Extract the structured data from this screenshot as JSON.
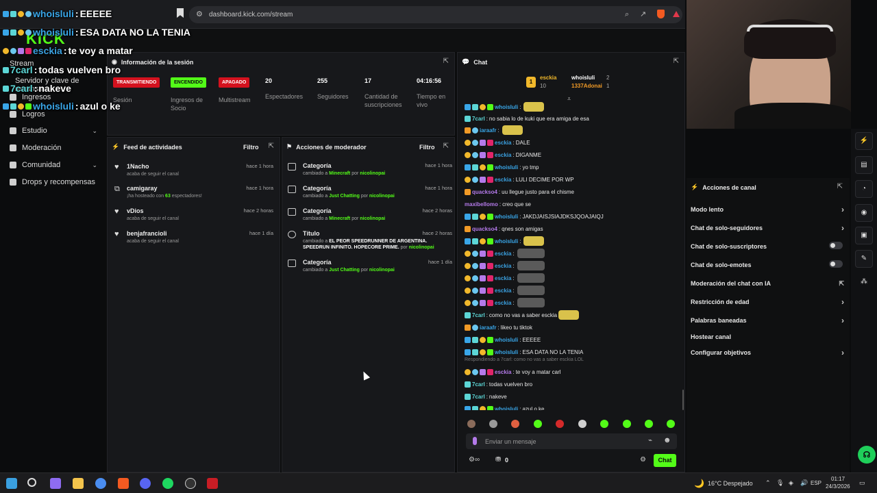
{
  "browser": {
    "url": "dashboard.kick.com/stream"
  },
  "overlay_chat": [
    {
      "user": "whoisluli",
      "text": "EEEEE",
      "color": "#39a6e8"
    },
    {
      "user": "whoisluli",
      "text": "ESA DATA NO LA TENIA",
      "color": "#39a6e8"
    },
    {
      "user": "esckia",
      "text": "te voy a matar",
      "color": "#3aa0e0"
    },
    {
      "user": "7carl",
      "text": "todas vuelven bro",
      "color": "#5cd6d6"
    },
    {
      "user": "7carl",
      "text": "nakeve",
      "color": "#5cd6d6"
    },
    {
      "user": "whoisluli",
      "text": "azul o ke",
      "color": "#39a6e8"
    }
  ],
  "sidebar": {
    "items": [
      {
        "label": "Stream"
      },
      {
        "label": "Servidor y clave de retransm"
      },
      {
        "label": "Ingresos"
      },
      {
        "label": "Logros"
      },
      {
        "label": "Estudio"
      },
      {
        "label": "Moderación"
      },
      {
        "label": "Comunidad"
      },
      {
        "label": "Drops y recompensas"
      }
    ]
  },
  "session": {
    "title": "Información de la sesión",
    "stats": [
      {
        "value": "TRANSMITIENDO",
        "label": "Sesión"
      },
      {
        "value": "ENCENDIDO",
        "label": "Ingresos de Socio"
      },
      {
        "value": "APAGADO",
        "label": "Multistream"
      },
      {
        "value": "20",
        "label": "Espectadores"
      },
      {
        "value": "255",
        "label": "Seguidores"
      },
      {
        "value": "17",
        "label": "Cantidad de suscripciones"
      },
      {
        "value": "04:16:56",
        "label": "Tiempo en vivo"
      }
    ]
  },
  "feed": {
    "title": "Feed de actividades",
    "filter": "Filtro",
    "items": [
      {
        "name": "1Nacho",
        "sub": "acaba de seguir el canal",
        "time": "hace 1 hora"
      },
      {
        "name": "camigaray",
        "sub_pre": "¡ha hosteado con ",
        "sub_num": "63",
        "sub_post": " espectadores!",
        "time": "hace 1 hora"
      },
      {
        "name": "vDios",
        "sub": "acaba de seguir el canal",
        "time": "hace 2 horas"
      },
      {
        "name": "benjafrancioli",
        "sub": "acaba de seguir el canal",
        "time": "hace 1 día"
      }
    ]
  },
  "mod": {
    "title": "Acciones de moderador",
    "filter": "Filtro",
    "items": [
      {
        "name": "Categoría",
        "pre": "cambiado a ",
        "target": "Minecraft",
        "mid": " por ",
        "by": "nicolinopai",
        "time": "hace 1 hora"
      },
      {
        "name": "Categoría",
        "pre": "cambiado a ",
        "target": "Just Chatting",
        "mid": " por ",
        "by": "nicolinopai",
        "time": "hace 1 hora"
      },
      {
        "name": "Categoría",
        "pre": "cambiado a ",
        "target": "Minecraft",
        "mid": " por ",
        "by": "nicolinopai",
        "time": "hace 2 horas"
      },
      {
        "name": "Título",
        "pre": "cambiado a ",
        "target": "EL PEOR SPEEDRUNNER DE ARGENTINA. SPEEDRUN INFINITO. HOPECORE PRIME.",
        "mid": " por ",
        "by": "nicolinopai",
        "time": "hace 2 horas"
      },
      {
        "name": "Categoría",
        "pre": "cambiado a ",
        "target": "Just Chatting",
        "mid": " por ",
        "by": "nicolinopai",
        "time": "hace 1 día"
      }
    ]
  },
  "chat": {
    "title": "Chat",
    "leaderboard": [
      {
        "rank": "1",
        "user": "esckia",
        "count": "10"
      },
      {
        "user": "whoisluli",
        "count": "2"
      },
      {
        "user": "1337Adonai",
        "count": "1"
      }
    ],
    "messages": [
      {
        "user": "whoisluli",
        "text": "",
        "color": "#39a6e8",
        "emote": true
      },
      {
        "user": "7carl",
        "text": "no sabia lo de kuki que era amiga de esa",
        "color": "#5cd6d6"
      },
      {
        "user": "iaraafr",
        "text": "",
        "color": "#39a6e8",
        "emote": true
      },
      {
        "user": "esckia",
        "text": "DALE",
        "color": "#3aa0e0"
      },
      {
        "user": "esckia",
        "text": "DIGANME",
        "color": "#3aa0e0"
      },
      {
        "user": "whoisluli",
        "text": "yo tmp",
        "color": "#39a6e8"
      },
      {
        "user": "esckia",
        "text": "LULI DECIME POR WP",
        "color": "#3aa0e0"
      },
      {
        "user": "quackso4",
        "text": "uu llegue justo para el chisme",
        "color": "#b47aea"
      },
      {
        "user": "maxibellomo",
        "text": "creo que se",
        "color": "#b47aea"
      },
      {
        "user": "whoisluli",
        "text": "JAKDJAISJSIAJDKSJQOAJAIQJ",
        "color": "#39a6e8"
      },
      {
        "user": "quackso4",
        "text": "qnes son amigas",
        "color": "#b47aea"
      },
      {
        "user": "whoisluli",
        "text": "",
        "color": "#39a6e8",
        "emote": true
      },
      {
        "user": "esckia",
        "text": "",
        "color": "#3aa0e0",
        "emote2": true
      },
      {
        "user": "esckia",
        "text": "",
        "color": "#3aa0e0",
        "emote2": true
      },
      {
        "user": "esckia",
        "text": "",
        "color": "#3aa0e0",
        "emote2": true
      },
      {
        "user": "esckia",
        "text": "",
        "color": "#3aa0e0",
        "emote2": true
      },
      {
        "user": "esckia",
        "text": "",
        "color": "#3aa0e0",
        "emote2": true
      },
      {
        "user": "7carl",
        "text": "como no vas a saber esckia",
        "color": "#5cd6d6",
        "emote": true
      },
      {
        "user": "iaraafr",
        "text": "likeo tu tiktok",
        "color": "#39a6e8"
      },
      {
        "user": "whoisluli",
        "text": "EEEEE",
        "color": "#39a6e8"
      },
      {
        "user": "whoisluli",
        "text": "ESA DATA NO LA TENIA",
        "color": "#39a6e8"
      },
      {
        "user": "esckia",
        "text": "te voy a matar carl",
        "color": "#b47aea",
        "reply": "Respondiendo a 7carl: como no vas a saber esckia LOL"
      },
      {
        "user": "7carl",
        "text": "todas vuelven bro",
        "color": "#5cd6d6"
      },
      {
        "user": "7carl",
        "text": "nakeve",
        "color": "#5cd6d6"
      },
      {
        "user": "whoisluli",
        "text": "azul o ke",
        "color": "#39a6e8"
      }
    ],
    "input_placeholder": "Enviar un mensaje",
    "points": "0",
    "send_label": "Chat"
  },
  "channel_actions": {
    "title": "Acciones de canal",
    "items": [
      {
        "label": "Modo lento",
        "kind": "chevron"
      },
      {
        "label": "Chat de solo-seguidores",
        "kind": "chevron"
      },
      {
        "label": "Chat de solo-suscriptores",
        "kind": "toggle"
      },
      {
        "label": "Chat de solo-emotes",
        "kind": "toggle"
      },
      {
        "label": "Moderación del chat con IA",
        "kind": "link"
      },
      {
        "label": "Restricción de edad",
        "kind": "chevron"
      },
      {
        "label": "Palabras baneadas",
        "kind": "chevron"
      },
      {
        "label": "Hostear canal",
        "kind": "none"
      },
      {
        "label": "Configurar objetivos",
        "kind": "chevron"
      }
    ]
  },
  "taskbar": {
    "weather": "16°C Despejado",
    "lang": "ESP",
    "time": "01:17",
    "date": "24/3/2026"
  },
  "colors": {
    "kick_green": "#53fc18",
    "live_red": "#d4111e"
  }
}
